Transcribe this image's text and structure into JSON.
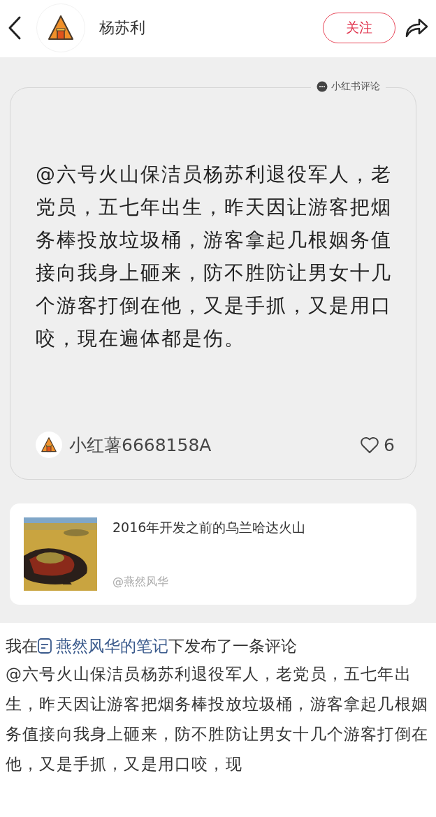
{
  "header": {
    "author": "杨苏利",
    "follow_button": "关注"
  },
  "comment_card": {
    "source_label": "小红书评论",
    "text": "@六号火山保洁员杨苏利退役军人，老党员，五七年出生，昨天因让游客把烟务棒投放垃圾桶，游客拿起几根姻务值接向我身上砸来，防不胜防让男女十几个游客打倒在他，又是手抓，又是用口咬，現在遍体都是伤。",
    "commenter": "小红薯6668158A",
    "likes": "6"
  },
  "note_card": {
    "title": "2016年开发之前的乌兰哈达火山",
    "author": "@燕然风华"
  },
  "post": {
    "prefix": "我在",
    "note_link": "燕然风华的笔记",
    "suffix": "下发布了一条评论",
    "body": "@六号火山保洁员杨苏利退役军人，老党员，五七年出生，昨天因让游客把烟务棒投放垃圾桶，游客拿起几根姻务值接向我身上砸来，防不胜防让男女十几个游客打倒在他，又是手抓，又是用口咬，现"
  }
}
